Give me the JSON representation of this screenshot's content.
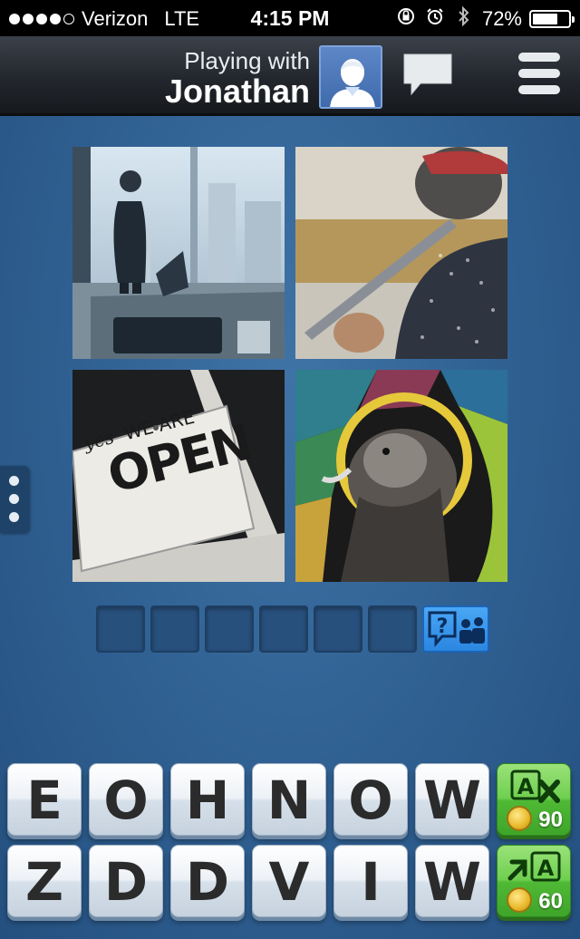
{
  "status_bar": {
    "carrier": "Verizon",
    "network": "LTE",
    "time": "4:15 PM",
    "battery": "72%",
    "battery_level": 0.72,
    "signal_bars_filled": 4,
    "icons": [
      "rotation-lock-icon",
      "alarm-icon",
      "bluetooth-icon"
    ]
  },
  "header": {
    "playing_label": "Playing with",
    "opponent_name": "Jonathan",
    "avatar_icon": "user-silhouette-icon",
    "chat_icon": "chat-bubble-icon",
    "menu_icon": "hamburger-menu-icon"
  },
  "puzzle": {
    "images": [
      {
        "subject": "businessman-at-window-image"
      },
      {
        "subject": "window-cleaner-squeegee-image"
      },
      {
        "subject": "open-sign-image",
        "sign_text_small": "yes",
        "sign_text_top": "WE ARE",
        "sign_text_main": "OPEN"
      },
      {
        "subject": "stained-glass-lion-image"
      }
    ],
    "answer_slots": 6,
    "hint_icon": "ask-friends-icon"
  },
  "keyboard": {
    "row1": [
      "E",
      "O",
      "H",
      "N",
      "O",
      "W"
    ],
    "row2": [
      "Z",
      "D",
      "D",
      "V",
      "I",
      "W"
    ],
    "powerups": [
      {
        "name": "remove-letters",
        "icon": "remove-letter-icon",
        "cost": "90"
      },
      {
        "name": "reveal-letter",
        "icon": "reveal-letter-icon",
        "cost": "60"
      }
    ]
  },
  "colors": {
    "background": "#2f5f91",
    "header": "#23272d",
    "hint_button": "#2a86e0",
    "powerup_button": "#4fb935",
    "key_text": "#2b2b2b"
  }
}
